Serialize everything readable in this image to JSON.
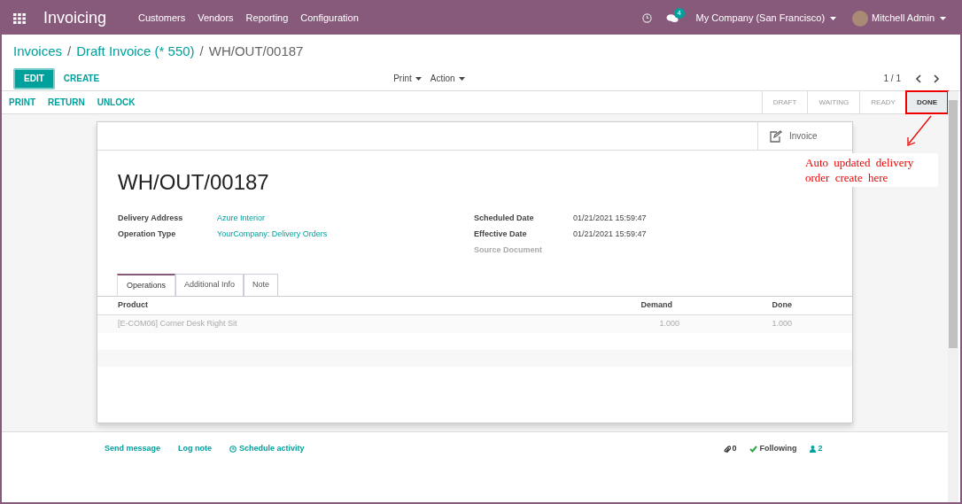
{
  "navbar": {
    "app_title": "Invoicing",
    "menu": [
      "Customers",
      "Vendors",
      "Reporting",
      "Configuration"
    ],
    "message_count": "4",
    "company": "My Company (San Francisco)",
    "user": "Mitchell Admin"
  },
  "breadcrumb_separator": "/",
  "breadcrumb": [
    {
      "label": "Invoices",
      "link": true
    },
    {
      "label": "Draft Invoice (* 550)",
      "link": true
    },
    {
      "label": "WH/OUT/00187",
      "link": false
    }
  ],
  "buttons": {
    "edit": "EDIT",
    "create": "CREATE",
    "print": "Print",
    "action": "Action",
    "pager": "1 / 1"
  },
  "header_buttons": [
    "PRINT",
    "RETURN",
    "UNLOCK"
  ],
  "stages": [
    {
      "label": "DRAFT",
      "selected": false
    },
    {
      "label": "WAITING",
      "selected": false
    },
    {
      "label": "READY",
      "selected": false
    },
    {
      "label": "DONE",
      "selected": true
    }
  ],
  "smart_button": "Invoice",
  "title": "WH/OUT/00187",
  "fields_left": [
    {
      "label": "Delivery Address",
      "value": "Azure Interior"
    },
    {
      "label": "Operation Type",
      "value": "YourCompany: Delivery Orders"
    }
  ],
  "fields_right": [
    {
      "label": "Scheduled Date",
      "value": "01/21/2021 15:59:47"
    },
    {
      "label": "Effective Date",
      "value": "01/21/2021 15:59:47"
    },
    {
      "label": "Source Document"
    }
  ],
  "tabs": [
    {
      "label": "Operations",
      "selected": true
    },
    {
      "label": "Additional Info",
      "selected": false
    },
    {
      "label": "Note",
      "selected": false
    }
  ],
  "table": {
    "columns": [
      "Product",
      "Demand",
      "Done"
    ],
    "rows": [
      [
        "[E-COM06] Corner Desk Right Sit",
        "1.000",
        "1.000"
      ]
    ]
  },
  "chatter": {
    "send_message": "Send message",
    "log_note": "Log note",
    "schedule_activity": "Schedule activity",
    "attachments": "0",
    "following": "Following",
    "followers": "2"
  },
  "annotation": "Auto updated delivery order create here"
}
